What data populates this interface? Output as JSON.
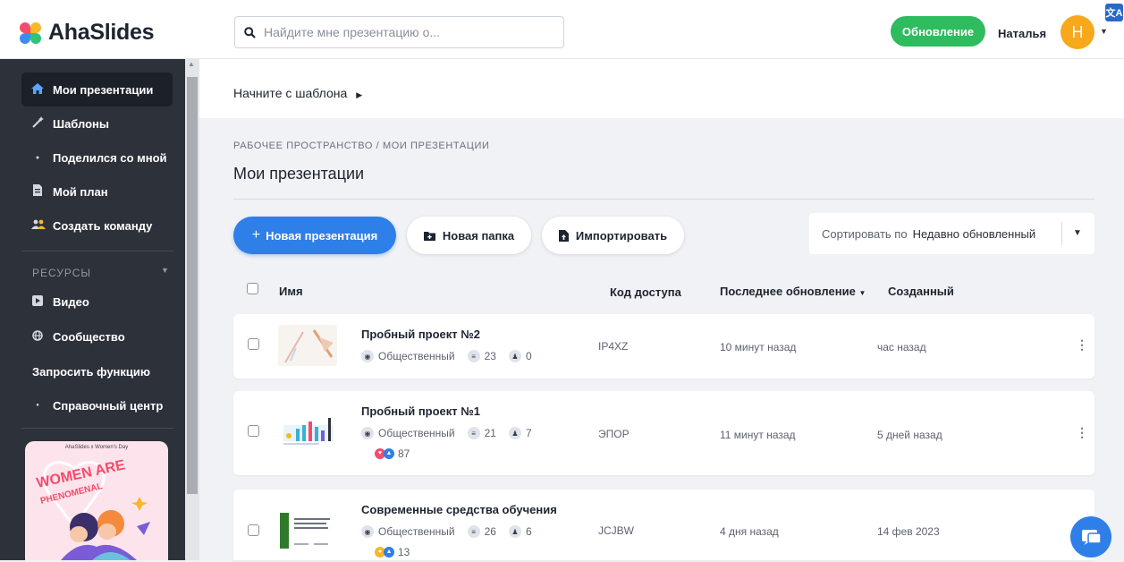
{
  "app": {
    "name": "AhaSlides"
  },
  "search": {
    "placeholder": "Найдите мне презентацию о..."
  },
  "header": {
    "upgrade_label": "Обновление",
    "user_name": "Наталья",
    "avatar_initial": "H",
    "translate_glyph": "文A"
  },
  "colors": {
    "accent": "#2f7fe8",
    "upgrade": "#2ebc5e",
    "sidebar": "#2d313a",
    "avatar": "#f7a81b"
  },
  "sidebar": {
    "items": [
      {
        "label": "Мои презентации",
        "icon": "home-icon",
        "active": true
      },
      {
        "label": "Шаблоны",
        "icon": "magic-wand-icon"
      },
      {
        "label": "Поделился со мной",
        "icon": "share-icon"
      },
      {
        "label": "Мой план",
        "icon": "document-icon"
      },
      {
        "label": "Создать команду",
        "icon": "team-icon"
      }
    ],
    "resources_label": "РЕСУРСЫ",
    "resources": [
      {
        "label": "Видео",
        "icon": "video-icon"
      },
      {
        "label": "Сообщество",
        "icon": "globe-icon"
      },
      {
        "label": "Запросить функцию",
        "icon": ""
      },
      {
        "label": "Справочный центр",
        "icon": "dot-icon"
      }
    ],
    "promo": {
      "header": "AhaSlides x Women's Day",
      "art_text": "WOMEN ARE PHENOMENAL"
    }
  },
  "main": {
    "template_link": "Начните с шаблона",
    "breadcrumb": "РАБОЧЕЕ ПРОСТРАНСТВО / МОИ ПРЕЗЕНТАЦИИ",
    "title": "Мои презентации",
    "new_presentation": "Новая презентация",
    "new_folder": "Новая папка",
    "import": "Импортировать",
    "sort_label": "Сортировать по",
    "sort_value": "Недавно обновленный"
  },
  "table": {
    "columns": {
      "name": "Имя",
      "code": "Код доступа",
      "updated": "Последнее обновление",
      "created": "Созданный"
    },
    "rows": [
      {
        "title": "Пробный проект №2",
        "visibility": "Общественный",
        "slides": "23",
        "participants": "0",
        "code": "IP4XZ",
        "updated": "10 минут назад",
        "created": "час назад",
        "reactions": ""
      },
      {
        "title": "Пробный проект №1",
        "visibility": "Общественный",
        "slides": "21",
        "participants": "7",
        "code": "ЭПОР",
        "updated": "11 минут назад",
        "created": "5 дней назад",
        "reactions": "87"
      },
      {
        "title": "Современные средства обучения",
        "visibility": "Общественный",
        "slides": "26",
        "participants": "6",
        "code": "JCJBW",
        "updated": "4 дня назад",
        "created": "14 фев 2023",
        "reactions": "13"
      }
    ]
  }
}
